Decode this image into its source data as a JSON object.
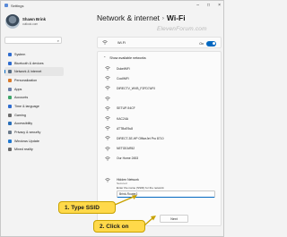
{
  "window": {
    "title": "Settings"
  },
  "profile": {
    "name": "Shawn Brink",
    "email": "outlook.com"
  },
  "search": {
    "placeholder": ""
  },
  "nav": [
    {
      "label": "System",
      "color": "#2e6ccf"
    },
    {
      "label": "Bluetooth & devices",
      "color": "#2e6ccf"
    },
    {
      "label": "Network & internet",
      "color": "#5a6f85",
      "active": true
    },
    {
      "label": "Personalization",
      "color": "#d97a2b"
    },
    {
      "label": "Apps",
      "color": "#6b7fa8"
    },
    {
      "label": "Accounts",
      "color": "#3ea66b"
    },
    {
      "label": "Time & language",
      "color": "#2e6ccf"
    },
    {
      "label": "Gaming",
      "color": "#6b6b6b"
    },
    {
      "label": "Accessibility",
      "color": "#2a6fb8"
    },
    {
      "label": "Privacy & security",
      "color": "#6b7a8a"
    },
    {
      "label": "Windows Update",
      "color": "#1f78d1"
    },
    {
      "label": "Mixed reality",
      "color": "#6a6a6a"
    }
  ],
  "breadcrumb": {
    "parent": "Network & internet",
    "separator": "›",
    "current": "Wi-Fi"
  },
  "watermark": "ElevenForum.com",
  "wifi": {
    "label": "Wi-Fi",
    "state": "On",
    "enabled": true
  },
  "available": {
    "header": "Show available networks"
  },
  "networks": [
    "DukeWiFi",
    "CoolWiFi",
    "DIRECTV_WVB_F2FD7AF0",
    "",
    "SETUP-94CF",
    "KAC24A",
    "ATTBxE9u8",
    "DIRECT-3E-HP OfficeJet Pro 8710",
    "NETGEAR52",
    "Our Home 2453"
  ],
  "hidden": {
    "title": "Hidden Network",
    "subtitle": "Secured",
    "ssid_label": "Enter the name (SSID) for the network",
    "ssid_value": "Brink-Router2",
    "next_label": "Next"
  },
  "callouts": {
    "step1": "1. Type SSID",
    "step2": "2. Click on"
  },
  "colors": {
    "accent": "#0067c0",
    "callout": "#ffd94a"
  }
}
